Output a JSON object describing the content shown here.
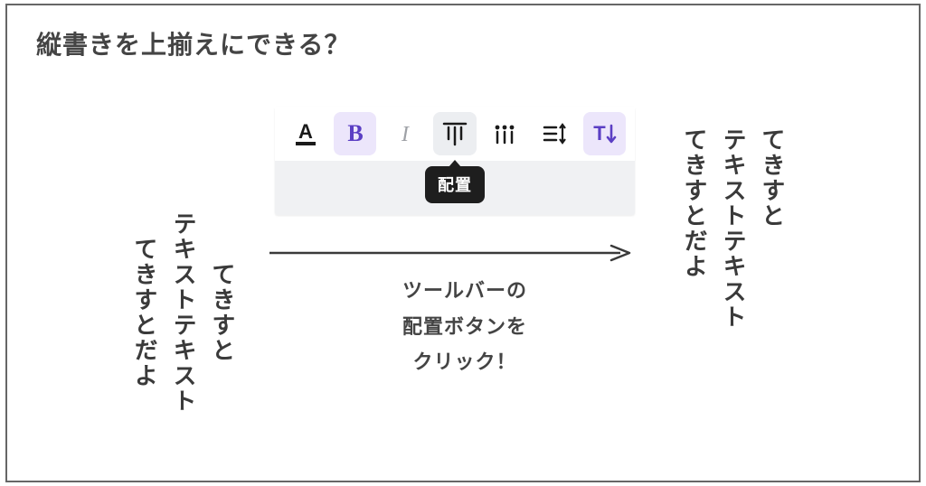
{
  "title": "縦書きを上揃えにできる？",
  "vertical_text": {
    "line1": "てきすと",
    "line2": "テキストテキスト",
    "line3": "てきすとだよ"
  },
  "toolbar": {
    "tooltip": "配置",
    "items": [
      {
        "name": "text-color",
        "label": "A"
      },
      {
        "name": "bold",
        "label": "B"
      },
      {
        "name": "italic",
        "label": "I"
      },
      {
        "name": "align",
        "label": "配置"
      },
      {
        "name": "list",
        "label": "リスト"
      },
      {
        "name": "line-spacing",
        "label": "行間"
      },
      {
        "name": "vertical-text",
        "label": "縦書き"
      }
    ]
  },
  "caption": {
    "l1": "ツールバーの",
    "l2": "配置ボタンを",
    "l3": "クリック！"
  }
}
